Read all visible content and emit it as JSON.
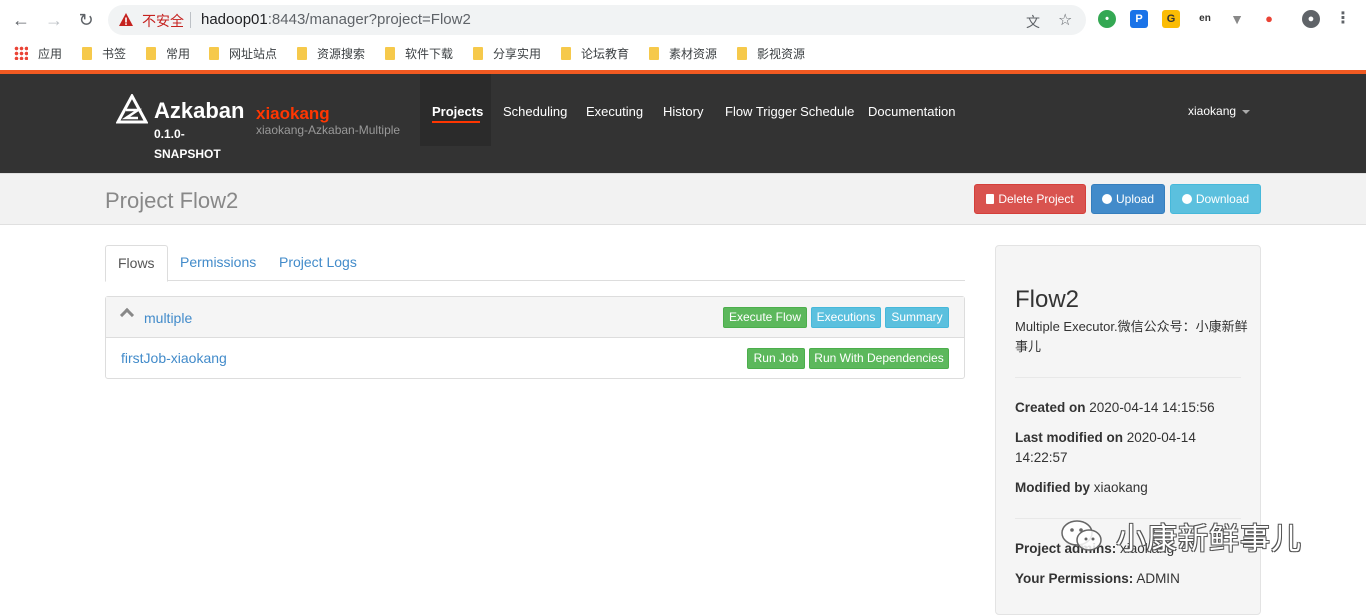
{
  "browser": {
    "insecure_label": "不安全",
    "url_host": "hadoop01",
    "url_rest": ":8443/manager?project=Flow2",
    "bookmarks": [
      "应用",
      "书签",
      "常用",
      "网址站点",
      "资源搜索",
      "软件下载",
      "分享实用",
      "论坛教育",
      "素材资源",
      "影视资源"
    ]
  },
  "nav": {
    "brand": "Azkaban",
    "version": "0.1.0-SNAPSHOT",
    "env_name": "xiaokang",
    "env_desc": "xiaokang-Azkaban-Multiple",
    "tabs": [
      "Projects",
      "Scheduling",
      "Executing",
      "History",
      "Flow Trigger Schedule",
      "Documentation"
    ],
    "active_tab": "Projects",
    "user": "xiaokang"
  },
  "header": {
    "title": "Project Flow2",
    "delete_label": "Delete Project",
    "upload_label": "Upload",
    "download_label": "Download"
  },
  "tabs": [
    "Flows",
    "Permissions",
    "Project Logs"
  ],
  "flows": {
    "flow_name": "multiple",
    "execute_label": "Execute Flow",
    "executions_label": "Executions",
    "summary_label": "Summary",
    "job_name": "firstJob-xiaokang",
    "run_job_label": "Run Job",
    "run_deps_label": "Run With Dependencies"
  },
  "sidebar": {
    "title": "Flow2",
    "description": "Multiple Executor.微信公众号：小康新鲜事儿",
    "created_label": "Created on",
    "created_value": "2020-04-14 14:15:56",
    "modified_label": "Last modified on",
    "modified_value": "2020-04-14 14:22:57",
    "modified_by_label": "Modified by",
    "modified_by_value": "xiaokang",
    "admins_label": "Project admins:",
    "admins_value": "xiaokang",
    "perm_label": "Your Permissions:",
    "perm_value": "ADMIN"
  },
  "watermark": "小康新鲜事儿",
  "colors": {
    "accent": "#ff3601",
    "nav_bg": "#333333",
    "danger": "#d9534f",
    "primary": "#428bca",
    "info": "#5bc0de",
    "success": "#5cb85c"
  }
}
